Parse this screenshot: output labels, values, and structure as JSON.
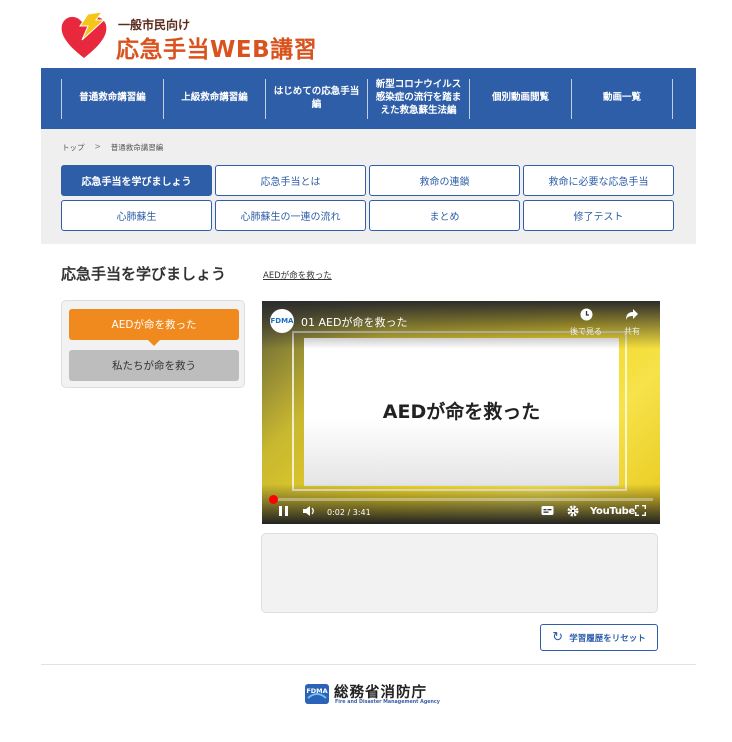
{
  "header": {
    "subtitle": "一般市民向け",
    "title": "応急手当WEB講習"
  },
  "nav": {
    "items": [
      {
        "label": "普通救命講習編"
      },
      {
        "label": "上級救命講習編"
      },
      {
        "label": "はじめての応急手当編"
      },
      {
        "label": "新型コロナウイルス感染症の流行を踏まえた救急蘇生法編"
      },
      {
        "label": "個別動画閲覧"
      },
      {
        "label": "動画一覧"
      }
    ]
  },
  "breadcrumb": {
    "home": "トップ",
    "separator": ">",
    "current": "普通救命講習編"
  },
  "subtabs": [
    {
      "label": "応急手当を学びましょう",
      "active": true
    },
    {
      "label": "応急手当とは"
    },
    {
      "label": "救命の連鎖"
    },
    {
      "label": "救命に必要な応急手当"
    },
    {
      "label": "心肺蘇生"
    },
    {
      "label": "心肺蘇生の一連の流れ"
    },
    {
      "label": "まとめ"
    },
    {
      "label": "修了テスト"
    }
  ],
  "section": {
    "title": "応急手当を学びましょう",
    "link": "AEDが命を救った"
  },
  "left_panel": {
    "items": [
      {
        "label": "AEDが命を救った",
        "state": "active"
      },
      {
        "label": "私たちが命を救う",
        "state": "inactive"
      }
    ]
  },
  "video": {
    "channel_logo_text": "FDMA",
    "title": "01 AEDが命を救った",
    "card_text": "AEDが命を救った",
    "watch_later_label": "後で見る",
    "share_label": "共有",
    "current_time": "0:02",
    "duration": "3:41",
    "time_display": "0:02 / 3:41",
    "progress": 0.009,
    "brand": "YouTube",
    "icons": {
      "watch_later": "clock-icon",
      "share": "share-icon",
      "play_pause": "pause-icon",
      "volume": "volume-icon",
      "captions": "captions-icon",
      "settings": "gear-icon",
      "fullscreen": "fullscreen-icon"
    }
  },
  "reset": {
    "label": "学習履歴をリセット",
    "icon": "refresh-icon"
  },
  "footer": {
    "org_logo_text": "FDMA",
    "org_name": "総務省消防庁",
    "org_name_en": "Fire and Disaster Management Agency"
  },
  "colors": {
    "brand_blue": "#2f5ea8",
    "accent_orange": "#f08a1e",
    "title_orange": "#d9531e",
    "logo_red": "#e8283c"
  }
}
